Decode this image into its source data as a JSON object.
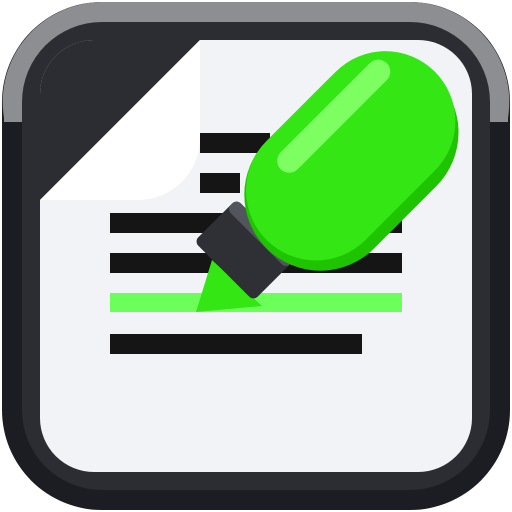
{
  "icon": {
    "name": "document-highlighter-icon",
    "colors": {
      "frame_outer": "#1b1d22",
      "frame_inner": "#2b2d33",
      "frame_highlight": "#8c8e92",
      "paper": "#f2f3f7",
      "paper_fold": "#ffffff",
      "text_line": "#151515",
      "highlight_line": "#6cff5a",
      "marker_body": "#33e614",
      "marker_shine": "#7dff62",
      "marker_shadow": "#1fc400",
      "marker_collar": "#2e3035",
      "marker_collar_light": "#52555b",
      "marker_tip": "#33e614"
    }
  }
}
